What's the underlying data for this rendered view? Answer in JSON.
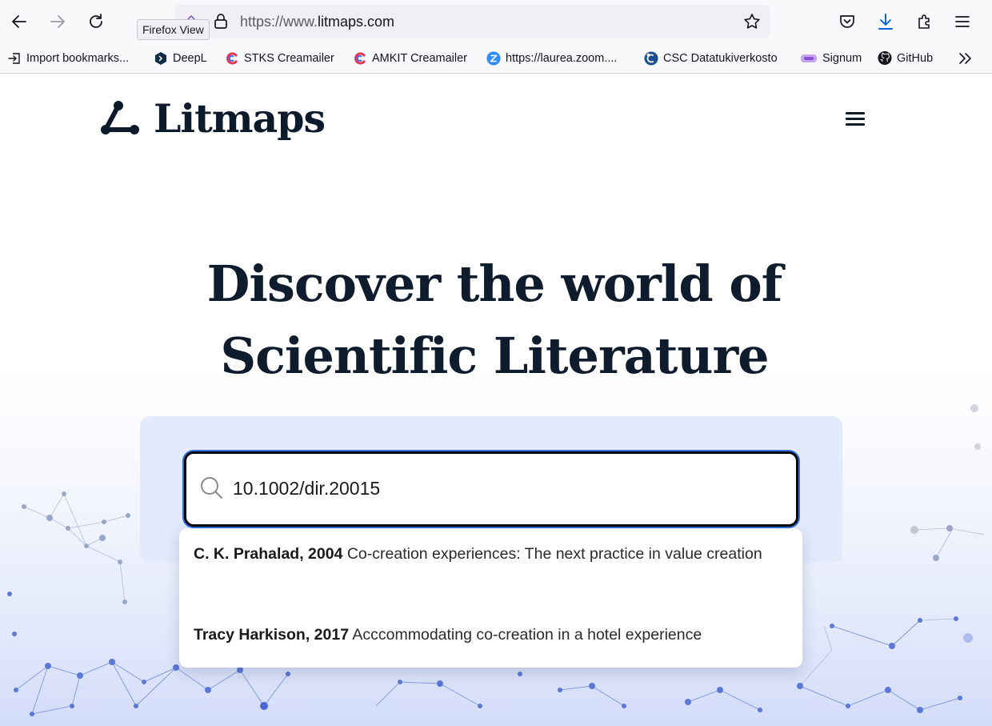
{
  "browser": {
    "url_prefix": "https://www.",
    "url_domain": "litmaps.com",
    "tooltip": "Firefox View"
  },
  "bookmarks": [
    {
      "label": "Import bookmarks...",
      "icon": "import-icon"
    },
    {
      "label": "DeepL",
      "icon": "deepl-icon"
    },
    {
      "label": "STKS Creamailer",
      "icon": "creamailer-icon"
    },
    {
      "label": "AMKIT Creamailer",
      "icon": "creamailer-icon"
    },
    {
      "label": "https://laurea.zoom....",
      "icon": "zoom-icon"
    },
    {
      "label": "CSC Datatukiverkosto",
      "icon": "csc-icon"
    },
    {
      "label": "Signum",
      "icon": "signum-icon"
    },
    {
      "label": "GitHub",
      "icon": "github-icon"
    }
  ],
  "site": {
    "logo_text": "Litmaps",
    "headline_line1": "Discover the world of",
    "headline_line2": "Scientific Literature"
  },
  "search": {
    "value": "10.1002/dir.20015",
    "results": [
      {
        "authors": "C. K. Prahalad, 2004",
        "title": "Co-creation experiences: The next practice in value creation"
      },
      {
        "authors": "Tracy Harkison, 2017",
        "title": "Acccommodating co-creation in a hotel experience"
      }
    ]
  },
  "colors": {
    "accent": "#2f6fe0",
    "headline": "#0f1c2e",
    "panel": "#e2eafb"
  }
}
